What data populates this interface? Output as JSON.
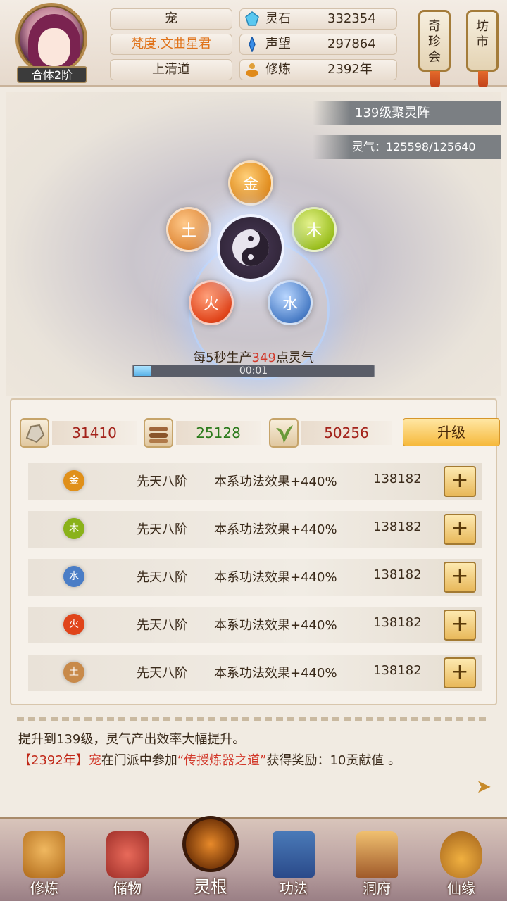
{
  "header": {
    "character_name": "宠",
    "title": "梵度.文曲星君",
    "sect": "上清道",
    "realm": "合体2阶",
    "stats": [
      {
        "label": "灵石",
        "value": "332354",
        "icon": "spirit-stone-icon"
      },
      {
        "label": "声望",
        "value": "297864",
        "icon": "prestige-icon"
      },
      {
        "label": "修炼",
        "value": "2392年",
        "icon": "cultivation-icon"
      }
    ],
    "side_buttons": [
      {
        "label": "奇珍会"
      },
      {
        "label": "坊市"
      }
    ]
  },
  "array": {
    "level_label": "139级聚灵阵",
    "qi_label": "灵气：125598/125640",
    "elements": {
      "gold": "金",
      "wood": "木",
      "earth": "土",
      "fire": "火",
      "water": "水"
    },
    "production": {
      "prefix": "每5秒生产",
      "amount": "349",
      "suffix": "点灵气"
    },
    "timer": "00:01",
    "progress": 0.07
  },
  "resources": [
    {
      "value": "31410",
      "color": "#a3221a",
      "icon": "ore-icon"
    },
    {
      "value": "25128",
      "color": "#2a7a1a",
      "icon": "wood-logs-icon"
    },
    {
      "value": "50256",
      "color": "#a3221a",
      "icon": "herb-icon"
    }
  ],
  "upgrade_label": "升级",
  "element_rows": [
    {
      "element": "金",
      "tier": "先天八阶",
      "effect": "本系功法效果+440%",
      "value": "138182",
      "color": "#e0901a"
    },
    {
      "element": "木",
      "tier": "先天八阶",
      "effect": "本系功法效果+440%",
      "value": "138182",
      "color": "#8ab21a"
    },
    {
      "element": "水",
      "tier": "先天八阶",
      "effect": "本系功法效果+440%",
      "value": "138182",
      "color": "#4a7dc6"
    },
    {
      "element": "火",
      "tier": "先天八阶",
      "effect": "本系功法效果+440%",
      "value": "138182",
      "color": "#e0441a"
    },
    {
      "element": "土",
      "tier": "先天八阶",
      "effect": "本系功法效果+440%",
      "value": "138182",
      "color": "#c88a4a"
    }
  ],
  "plus_label": "+",
  "log": {
    "line1": "提升到139级，灵气产出效率大幅提升。",
    "line2_year": "【2392年】",
    "line2_name": "宠",
    "line2_mid": "在门派中参加",
    "line2_event": "“传授炼器之道”",
    "line2_end": "获得奖励：10贡献值 。"
  },
  "nav": [
    {
      "label": "修炼",
      "icon": "meditation-icon"
    },
    {
      "label": "储物",
      "icon": "pouch-icon"
    },
    {
      "label": "灵根",
      "icon": "spirit-root-icon"
    },
    {
      "label": "功法",
      "icon": "scroll-book-icon"
    },
    {
      "label": "洞府",
      "icon": "cave-house-icon"
    },
    {
      "label": "仙缘",
      "icon": "gourd-icon"
    }
  ]
}
